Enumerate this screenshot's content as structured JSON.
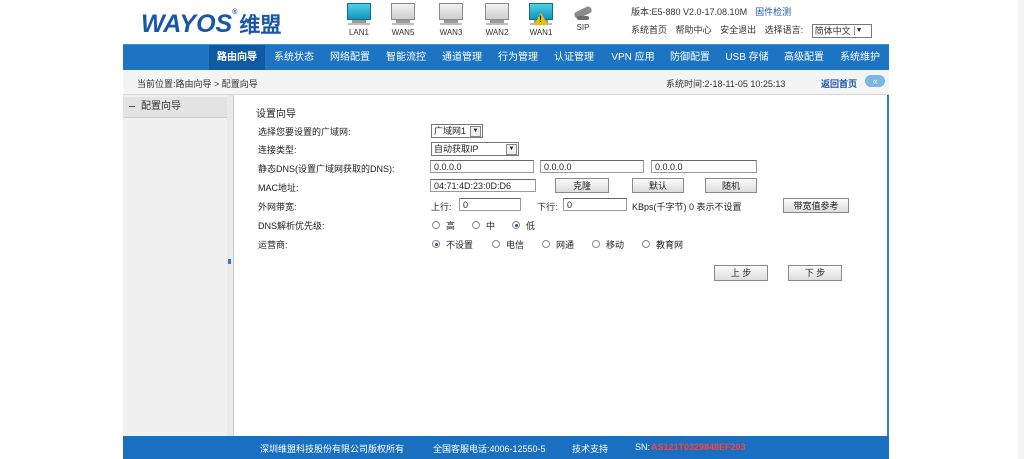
{
  "header": {
    "logo_text": "WAYOS",
    "logo_reg": "®",
    "logo_cn": "维盟",
    "version": "版本:E5-880 V2.0-17.08.10M",
    "update_link": "固件检测",
    "links": [
      "系统首页",
      "帮助中心",
      "安全退出",
      "选择语言:"
    ],
    "language": "简体中文"
  },
  "ports": [
    {
      "label": "LAN1",
      "state": "inactive-cyan"
    },
    {
      "label": "WAN5",
      "state": "inactive"
    },
    {
      "label": "WAN3",
      "state": "inactive"
    },
    {
      "label": "WAN2",
      "state": "inactive"
    },
    {
      "label": "WAN1",
      "state": "warning"
    },
    {
      "label": "SIP",
      "state": "icon"
    }
  ],
  "nav": [
    "路由向导",
    "系统状态",
    "网络配置",
    "智能流控",
    "通道管理",
    "行为管理",
    "认证管理",
    "VPN 应用",
    "防御配置",
    "USB 存储",
    "高级配置",
    "系统维护"
  ],
  "breadcrumb": {
    "location": "当前位置:路由向导 > 配置向导",
    "system_time": "系统时间:2-18-11-05 10:25:13",
    "back_link": "返回首页"
  },
  "sidebar": {
    "items": [
      {
        "label": "配置向导"
      }
    ]
  },
  "form": {
    "title": "设置向导",
    "wan_label": "选择您要设置的广域网:",
    "wan_value": "广域网1",
    "conn_type_label": "连接类型:",
    "conn_type_value": "自动获取IP",
    "dns_label": "静态DNS(设置广域网获取的DNS):",
    "dns1": "0.0.0.0",
    "dns2": "0.0.0.0",
    "dns3": "0.0.0.0",
    "mac_label": "MAC地址:",
    "mac_value": "04:71:4D:23:0D:D6",
    "clone_btn": "克隆",
    "default_btn": "默认",
    "random_btn": "随机",
    "bw_label": "外网带宽:",
    "up_label": "上行:",
    "up_value": "0",
    "down_label": "下行:",
    "down_value": "0",
    "bw_unit": "KBps(千字节) 0 表示不设置",
    "bw_ref_btn": "带宽值参考",
    "dns_pri_label": "DNS解析优先级:",
    "dns_pri_options": [
      "高",
      "中",
      "低"
    ],
    "dns_pri_selected": 2,
    "isp_label": "运营商:",
    "isp_options": [
      "不设置",
      "电信",
      "网通",
      "移动",
      "教育网"
    ],
    "isp_selected": 0,
    "prev_btn": "上 步",
    "next_btn": "下 步"
  },
  "footer": {
    "copyright": "深圳维盟科技股份有限公司版权所有",
    "hotline": "全国客服电话:4006-12550-5",
    "support": "技术支持",
    "sn_label": "SN:",
    "sn_value": "AS121T0329848EF203"
  },
  "colors": {
    "nav_bg": "#1d74c2",
    "brand": "#1a56a8",
    "sn": "#ff4040"
  }
}
